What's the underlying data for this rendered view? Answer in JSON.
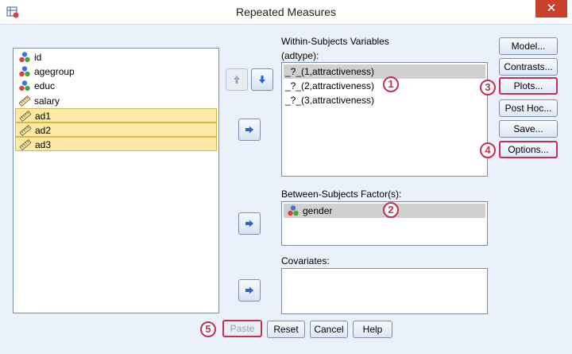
{
  "window": {
    "title": "Repeated Measures",
    "close_glyph": "✕"
  },
  "source_list": {
    "items": [
      {
        "label": "id",
        "icon": "nominal-icon",
        "selected": false
      },
      {
        "label": "agegroup",
        "icon": "nominal-icon",
        "selected": false
      },
      {
        "label": "educ",
        "icon": "nominal-icon",
        "selected": false
      },
      {
        "label": "salary",
        "icon": "scale-icon",
        "selected": false
      },
      {
        "label": "ad1",
        "icon": "scale-icon",
        "selected": true
      },
      {
        "label": "ad2",
        "icon": "scale-icon",
        "selected": true
      },
      {
        "label": "ad3",
        "icon": "scale-icon",
        "selected": true
      }
    ]
  },
  "within": {
    "heading": "Within-Subjects Variables",
    "factor": "(adtype):",
    "items": [
      {
        "label": "_?_(1,attractiveness)",
        "selected": true
      },
      {
        "label": "_?_(2,attractiveness)",
        "selected": false
      },
      {
        "label": "_?_(3,attractiveness)",
        "selected": false
      }
    ]
  },
  "between": {
    "heading": "Between-Subjects Factor(s):",
    "items": [
      {
        "label": "gender",
        "icon": "nominal-icon",
        "selected": true
      }
    ]
  },
  "covariates": {
    "heading": "Covariates:",
    "items": []
  },
  "side_buttons": {
    "model": "Model...",
    "contrasts": "Contrasts...",
    "plots": "Plots...",
    "posthoc": "Post Hoc...",
    "save": "Save...",
    "options": "Options..."
  },
  "bottom_buttons": {
    "paste": "Paste",
    "reset": "Reset",
    "cancel": "Cancel",
    "help": "Help"
  },
  "badges": {
    "b1": "1",
    "b2": "2",
    "b3": "3",
    "b4": "4",
    "b5": "5"
  },
  "colors": {
    "dialog_bg": "#eaf1fb",
    "highlight": "#c4304f",
    "selected_bg": "#fce9a6",
    "arrow_blue": "#2f63c7"
  }
}
